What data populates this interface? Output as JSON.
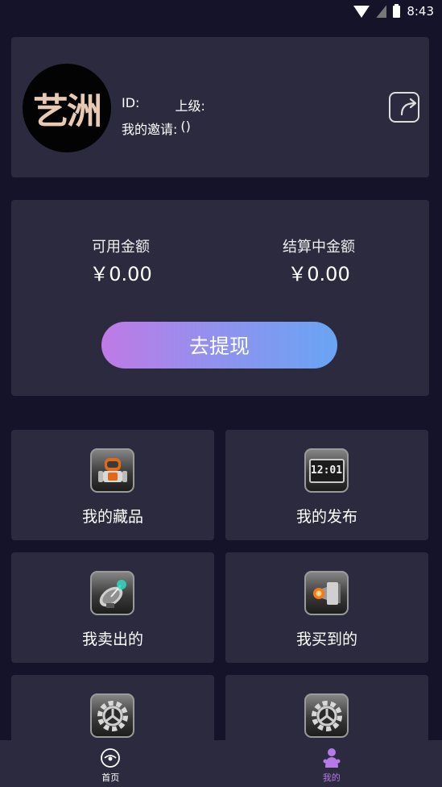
{
  "status_bar": {
    "time": "8:43"
  },
  "profile": {
    "avatar_text": "艺洲",
    "id_label": "ID:",
    "id_value": "",
    "superior_label": "上级:",
    "superior_value": "",
    "invite_label": "我的邀请:",
    "invite_value": "()"
  },
  "balance": {
    "available_label": "可用金额",
    "available_value": "￥0.00",
    "settling_label": "结算中金额",
    "settling_value": "￥0.00",
    "withdraw_label": "去提现"
  },
  "menu": {
    "items": [
      {
        "label": "我的藏品",
        "icon": "robot-icon"
      },
      {
        "label": "我的发布",
        "icon": "clock-icon"
      },
      {
        "label": "我卖出的",
        "icon": "satellite-icon"
      },
      {
        "label": "我买到的",
        "icon": "speaker-icon"
      },
      {
        "label": "",
        "icon": "gear-icon"
      },
      {
        "label": "",
        "icon": "gear-icon"
      }
    ],
    "clock_text": "12:01"
  },
  "bottom_nav": {
    "items": [
      {
        "label": "首页",
        "icon": "home-eye-icon",
        "active": false
      },
      {
        "label": "我的",
        "icon": "person-icon",
        "active": true
      }
    ],
    "active_color": "#b57ae6",
    "inactive_color": "#ffffff"
  }
}
